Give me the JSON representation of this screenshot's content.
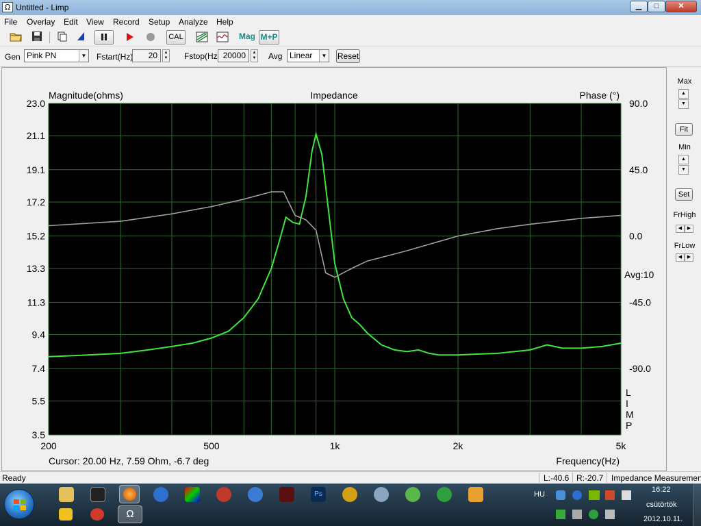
{
  "window": {
    "title": "Untitled - Limp",
    "app_icon_glyph": "Ω",
    "buttons": {
      "minimize": "▁",
      "maximize": "□",
      "close": "✕"
    }
  },
  "menu": [
    "File",
    "Overlay",
    "Edit",
    "View",
    "Record",
    "Setup",
    "Analyze",
    "Help"
  ],
  "toolbar": {
    "cal_label": "CAL",
    "mag_label": "Mag",
    "mp_label": "M+P",
    "accent_mag": "#1a8a8a",
    "record_color": "#e01010"
  },
  "controls": {
    "gen_label": "Gen",
    "gen_value": "Pink PN",
    "fstart_label": "Fstart(Hz)",
    "fstart_value": "20",
    "fstop_label": "Fstop(Hz)",
    "fstop_value": "20000",
    "avg_label": "Avg",
    "avg_value": "Linear",
    "reset_label": "Reset"
  },
  "plot": {
    "title": "Impedance",
    "left_axis_label": "Magnitude(ohms)",
    "right_axis_label": "Phase (°)",
    "x_axis_label": "Frequency(Hz)",
    "avg_text": "Avg:10",
    "limp_letters": [
      "L",
      "I",
      "M",
      "P"
    ],
    "cursor_text": "Cursor: 20.00 Hz, 7.59 Ohm, -6.7 deg",
    "background": "#000000",
    "grid_color": "#2e6b2e",
    "magnitude_color": "#3ee63e",
    "phase_color": "#a0a0a0"
  },
  "chart_data": {
    "type": "line",
    "title": "Impedance",
    "xlabel": "Frequency(Hz)",
    "ylabel": "Magnitude(ohms)",
    "y2label": "Phase (°)",
    "xscale": "log",
    "xlim": [
      200,
      5000
    ],
    "ylim": [
      3.5,
      23.0
    ],
    "y2lim": [
      -135,
      90
    ],
    "x_ticks": [
      "200",
      "500",
      "1k",
      "2k",
      "5k"
    ],
    "y_ticks": [
      "23.0",
      "21.1",
      "19.1",
      "17.2",
      "15.2",
      "13.3",
      "11.3",
      "9.4",
      "7.4",
      "5.5",
      "3.5"
    ],
    "y2_ticks": [
      "90.0",
      "45.0",
      "0.0",
      "-45.0",
      "-90.0"
    ],
    "grid": true,
    "series": [
      {
        "name": "Magnitude",
        "axis": "left",
        "color": "#3ee63e",
        "x": [
          200,
          250,
          300,
          350,
          400,
          450,
          500,
          550,
          600,
          650,
          700,
          730,
          760,
          790,
          820,
          850,
          880,
          900,
          930,
          960,
          1000,
          1050,
          1100,
          1150,
          1200,
          1300,
          1400,
          1500,
          1600,
          1700,
          1800,
          2000,
          2200,
          2500,
          3000,
          3300,
          3600,
          4000,
          4500,
          5000
        ],
        "y": [
          8.1,
          8.2,
          8.3,
          8.5,
          8.7,
          8.9,
          9.2,
          9.6,
          10.4,
          11.5,
          13.3,
          14.8,
          16.3,
          16.0,
          15.9,
          17.5,
          20.2,
          21.2,
          20.0,
          17.2,
          13.6,
          11.5,
          10.4,
          10.0,
          9.5,
          8.8,
          8.5,
          8.4,
          8.5,
          8.3,
          8.2,
          8.2,
          8.25,
          8.3,
          8.5,
          8.8,
          8.6,
          8.6,
          8.7,
          8.9
        ]
      },
      {
        "name": "Phase",
        "axis": "right",
        "color": "#a0a0a0",
        "x": [
          200,
          300,
          400,
          500,
          600,
          700,
          750,
          800,
          850,
          900,
          950,
          1000,
          1100,
          1200,
          1500,
          2000,
          2500,
          3000,
          4000,
          5000
        ],
        "y": [
          7,
          10,
          15,
          20,
          25,
          30,
          30,
          14,
          11,
          4,
          -25,
          -28,
          -22,
          -17,
          -10,
          0,
          5,
          8,
          12,
          14
        ]
      }
    ]
  },
  "right_panel": {
    "max_label": "Max",
    "fit_label": "Fit",
    "min_label": "Min",
    "set_label": "Set",
    "frhigh_label": "FrHigh",
    "frlow_label": "FrLow"
  },
  "statusbar": {
    "status": "Ready",
    "left_level": "L:-40.6",
    "right_level": "R:-20.7",
    "mode": "Impedance Measuremen"
  },
  "taskbar": {
    "language": "HU",
    "time": "16:22",
    "day": "csütörtök",
    "date": "2012.10.11.",
    "active_app_glyph": "Ω"
  }
}
